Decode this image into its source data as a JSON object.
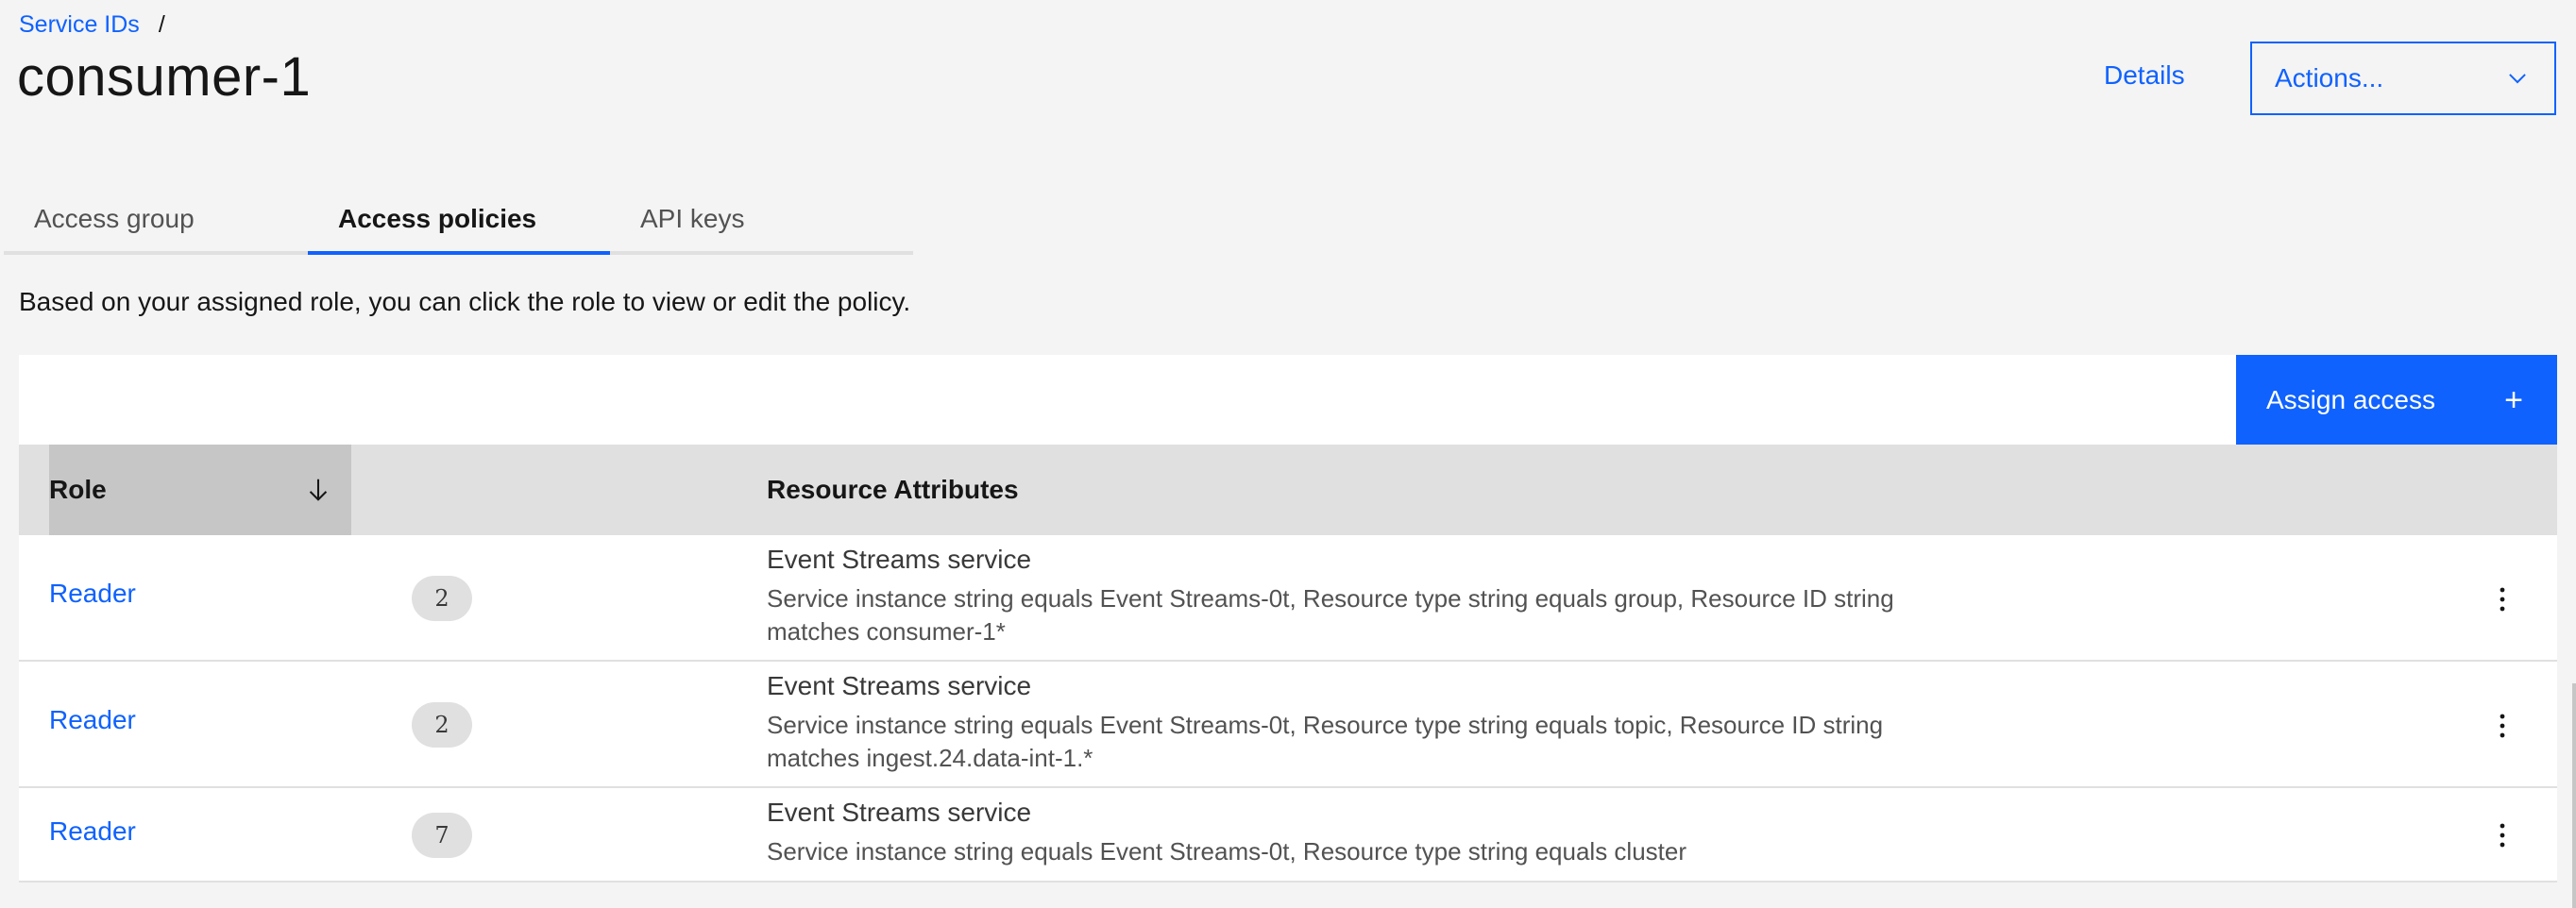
{
  "breadcrumb": {
    "link": "Service IDs",
    "separator": "/"
  },
  "page_title": "consumer-1",
  "header": {
    "details_label": "Details",
    "actions_label": "Actions..."
  },
  "tabs": [
    {
      "label": "Access group",
      "active": false
    },
    {
      "label": "Access policies",
      "active": true
    },
    {
      "label": "API keys",
      "active": false
    }
  ],
  "helper_text": "Based on your assigned role, you can click the role to view or edit the policy.",
  "toolbar": {
    "assign_label": "Assign access",
    "assign_icon": "+"
  },
  "table": {
    "headers": {
      "role": "Role",
      "resource_attributes": "Resource Attributes"
    },
    "rows": [
      {
        "role": "Reader",
        "count": "2",
        "resource_title": "Event Streams service",
        "resource_desc_1": "Service instance string equals Event Streams-0t, Resource type string equals group, Resource ID string",
        "resource_desc_2": "matches consumer-1*"
      },
      {
        "role": "Reader",
        "count": "2",
        "resource_title": "Event Streams service",
        "resource_desc_1": "Service instance string equals Event Streams-0t, Resource type string equals topic, Resource ID string",
        "resource_desc_2": "matches ingest.24.data-int-1.*"
      },
      {
        "role": "Reader",
        "count": "7",
        "resource_title": "Event Streams service",
        "resource_desc_1": "Service instance string equals Event Streams-0t, Resource type string equals cluster",
        "resource_desc_2": ""
      }
    ]
  },
  "colors": {
    "primary": "#0f62fe",
    "background": "#f4f4f4",
    "header_bg": "#e0e0e0",
    "sorted_header_bg": "#c6c6c6"
  },
  "icons": {
    "dropdown": "chevron-down-icon",
    "sort": "arrow-down-icon",
    "overflow": "overflow-menu-vertical-icon",
    "add": "plus-icon"
  }
}
